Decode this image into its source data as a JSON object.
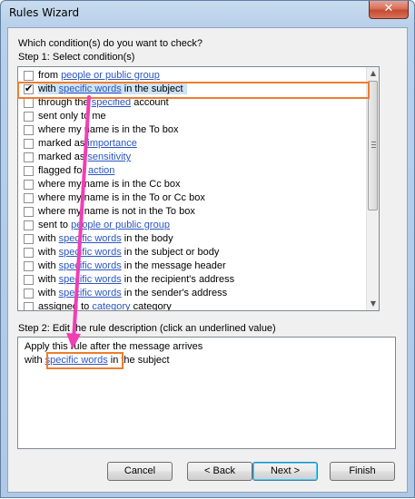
{
  "window": {
    "title": "Rules Wizard",
    "close_symbol": "✕"
  },
  "question": "Which condition(s) do you want to check?",
  "step1_label": "Step 1: Select condition(s)",
  "conditions": [
    {
      "checked": false,
      "parts": [
        {
          "t": "from "
        },
        {
          "t": "people or public group",
          "link": true
        }
      ]
    },
    {
      "checked": true,
      "selected": true,
      "parts": [
        {
          "t": "with "
        },
        {
          "t": "specific words",
          "link": true
        },
        {
          "t": " in the subject"
        }
      ]
    },
    {
      "checked": false,
      "parts": [
        {
          "t": "through the "
        },
        {
          "t": "specified",
          "link": true
        },
        {
          "t": " account"
        }
      ]
    },
    {
      "checked": false,
      "parts": [
        {
          "t": "sent only to me"
        }
      ]
    },
    {
      "checked": false,
      "parts": [
        {
          "t": "where my name is in the To box"
        }
      ]
    },
    {
      "checked": false,
      "parts": [
        {
          "t": "marked as "
        },
        {
          "t": "importance",
          "link": true
        }
      ]
    },
    {
      "checked": false,
      "parts": [
        {
          "t": "marked as "
        },
        {
          "t": "sensitivity",
          "link": true
        }
      ]
    },
    {
      "checked": false,
      "parts": [
        {
          "t": "flagged for "
        },
        {
          "t": "action",
          "link": true
        }
      ]
    },
    {
      "checked": false,
      "parts": [
        {
          "t": "where my name is in the Cc box"
        }
      ]
    },
    {
      "checked": false,
      "parts": [
        {
          "t": "where my name is in the To or Cc box"
        }
      ]
    },
    {
      "checked": false,
      "parts": [
        {
          "t": "where my name is not in the To box"
        }
      ]
    },
    {
      "checked": false,
      "parts": [
        {
          "t": "sent to "
        },
        {
          "t": "people or public group",
          "link": true
        }
      ]
    },
    {
      "checked": false,
      "parts": [
        {
          "t": "with "
        },
        {
          "t": "specific words",
          "link": true
        },
        {
          "t": " in the body"
        }
      ]
    },
    {
      "checked": false,
      "parts": [
        {
          "t": "with "
        },
        {
          "t": "specific words",
          "link": true
        },
        {
          "t": " in the subject or body"
        }
      ]
    },
    {
      "checked": false,
      "parts": [
        {
          "t": "with "
        },
        {
          "t": "specific words",
          "link": true
        },
        {
          "t": " in the message header"
        }
      ]
    },
    {
      "checked": false,
      "parts": [
        {
          "t": "with "
        },
        {
          "t": "specific words",
          "link": true
        },
        {
          "t": " in the recipient's address"
        }
      ]
    },
    {
      "checked": false,
      "parts": [
        {
          "t": "with "
        },
        {
          "t": "specific words",
          "link": true
        },
        {
          "t": " in the sender's address"
        }
      ]
    },
    {
      "checked": false,
      "parts": [
        {
          "t": "assigned to "
        },
        {
          "t": "category",
          "link": true
        },
        {
          "t": " category"
        }
      ]
    }
  ],
  "step2_label": "Step 2: Edit the rule description (click an underlined value)",
  "description": {
    "line1": "Apply this rule after the message arrives",
    "line2_prefix": "with ",
    "line2_link": "specific words",
    "line2_suffix": " in the subject"
  },
  "buttons": {
    "cancel": "Cancel",
    "back": "< Back",
    "next": "Next >",
    "finish": "Finish"
  },
  "colors": {
    "highlight_outline": "#ee7d2e",
    "annotation_arrow": "#f03fb4",
    "link": "#2a55c0",
    "selection": "#cde3f7"
  }
}
